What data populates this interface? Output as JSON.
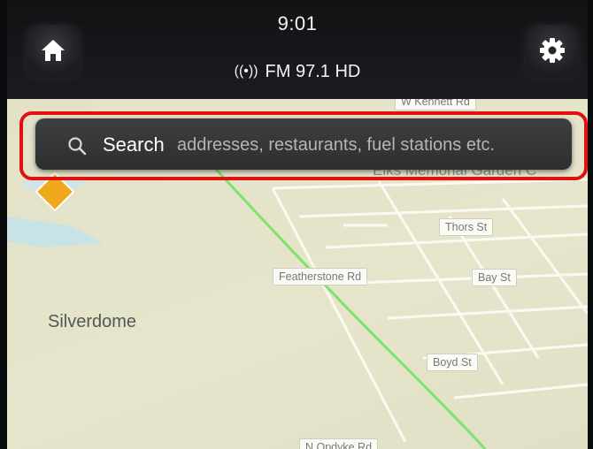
{
  "status": {
    "time": "9:01",
    "radio": "FM 97.1 HD"
  },
  "icons": {
    "home": "home-icon",
    "settings": "gear-icon",
    "radio": "antenna-icon",
    "search": "search-icon",
    "hazard": "warning-icon"
  },
  "search": {
    "label": "Search",
    "placeholder": "addresses, restaurants, fuel stations etc."
  },
  "map": {
    "area": "Silverdome",
    "poi": "Elks Memorial Garden C",
    "streets": [
      "W Kennett Rd",
      "Thors St",
      "Featherstone Rd",
      "Bay St",
      "Boyd St",
      "N Opdyke Rd"
    ]
  },
  "colors": {
    "highlight": "#e31010",
    "map_background": "#e6e5cc",
    "route": "#7ee36a",
    "water": "#bfe3ef"
  }
}
